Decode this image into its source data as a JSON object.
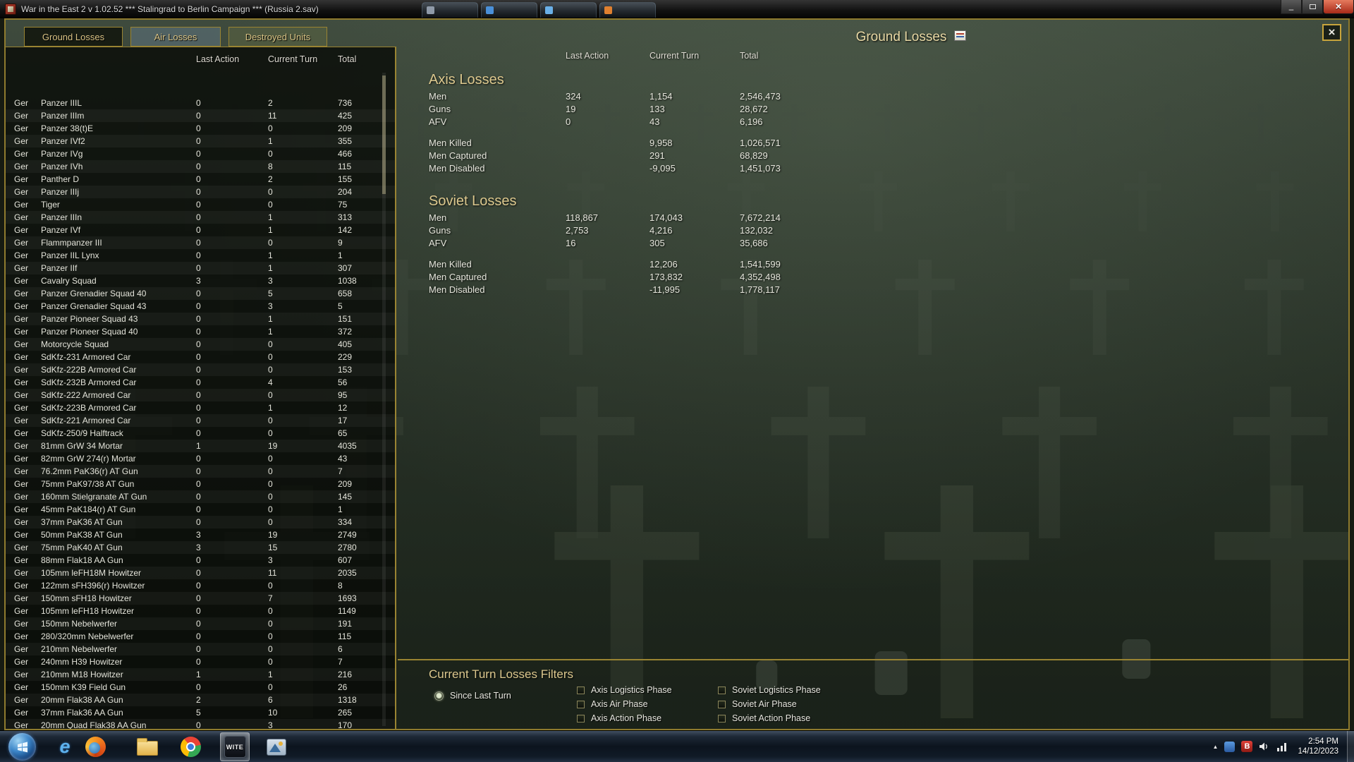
{
  "titlebar": {
    "title": "War in the East 2  v 1.02.52      ***  Stalingrad to Berlin Campaign   ***   (Russia 2.sav)",
    "window_buttons": [
      "minimize",
      "maximize",
      "close"
    ],
    "background_tabs_count": 4
  },
  "window": {
    "title": "Ground Losses",
    "icons": [
      "report-icon",
      "close-icon"
    ]
  },
  "tabs": [
    {
      "label": "Ground Losses",
      "active": true
    },
    {
      "label": "Air Losses",
      "active": false
    },
    {
      "label": "Destroyed Units",
      "active": false
    }
  ],
  "table": {
    "headers": [
      "Last Action",
      "Current Turn",
      "Total"
    ],
    "rows": [
      [
        "Ger",
        "Panzer IIIL",
        "0",
        "2",
        "736"
      ],
      [
        "Ger",
        "Panzer IIIm",
        "0",
        "11",
        "425"
      ],
      [
        "Ger",
        "Panzer 38(t)E",
        "0",
        "0",
        "209"
      ],
      [
        "Ger",
        "Panzer IVf2",
        "0",
        "1",
        "355"
      ],
      [
        "Ger",
        "Panzer IVg",
        "0",
        "0",
        "466"
      ],
      [
        "Ger",
        "Panzer IVh",
        "0",
        "8",
        "115"
      ],
      [
        "Ger",
        "Panther D",
        "0",
        "2",
        "155"
      ],
      [
        "Ger",
        "Panzer IIIj",
        "0",
        "0",
        "204"
      ],
      [
        "Ger",
        "Tiger",
        "0",
        "0",
        "75"
      ],
      [
        "Ger",
        "Panzer IIIn",
        "0",
        "1",
        "313"
      ],
      [
        "Ger",
        "Panzer IVf",
        "0",
        "1",
        "142"
      ],
      [
        "Ger",
        "Flammpanzer III",
        "0",
        "0",
        "9"
      ],
      [
        "Ger",
        "Panzer IIL Lynx",
        "0",
        "1",
        "1"
      ],
      [
        "Ger",
        "Panzer IIf",
        "0",
        "1",
        "307"
      ],
      [
        "Ger",
        "Cavalry Squad",
        "3",
        "3",
        "1038"
      ],
      [
        "Ger",
        "Panzer Grenadier Squad 40",
        "0",
        "5",
        "658"
      ],
      [
        "Ger",
        "Panzer Grenadier Squad 43",
        "0",
        "3",
        "5"
      ],
      [
        "Ger",
        "Panzer Pioneer Squad 43",
        "0",
        "1",
        "151"
      ],
      [
        "Ger",
        "Panzer Pioneer Squad 40",
        "0",
        "1",
        "372"
      ],
      [
        "Ger",
        "Motorcycle Squad",
        "0",
        "0",
        "405"
      ],
      [
        "Ger",
        "SdKfz-231 Armored Car",
        "0",
        "0",
        "229"
      ],
      [
        "Ger",
        "SdKfz-222B Armored Car",
        "0",
        "0",
        "153"
      ],
      [
        "Ger",
        "SdKfz-232B Armored Car",
        "0",
        "4",
        "56"
      ],
      [
        "Ger",
        "SdKfz-222 Armored Car",
        "0",
        "0",
        "95"
      ],
      [
        "Ger",
        "SdKfz-223B Armored Car",
        "0",
        "1",
        "12"
      ],
      [
        "Ger",
        "SdKfz-221 Armored Car",
        "0",
        "0",
        "17"
      ],
      [
        "Ger",
        "SdKfz-250/9 Halftrack",
        "0",
        "0",
        "65"
      ],
      [
        "Ger",
        "81mm GrW 34 Mortar",
        "1",
        "19",
        "4035"
      ],
      [
        "Ger",
        "82mm GrW 274(r) Mortar",
        "0",
        "0",
        "43"
      ],
      [
        "Ger",
        "76.2mm PaK36(r) AT Gun",
        "0",
        "0",
        "7"
      ],
      [
        "Ger",
        "75mm PaK97/38 AT Gun",
        "0",
        "0",
        "209"
      ],
      [
        "Ger",
        "160mm Stielgranate AT Gun",
        "0",
        "0",
        "145"
      ],
      [
        "Ger",
        "45mm PaK184(r) AT Gun",
        "0",
        "0",
        "1"
      ],
      [
        "Ger",
        "37mm PaK36 AT Gun",
        "0",
        "0",
        "334"
      ],
      [
        "Ger",
        "50mm PaK38 AT Gun",
        "3",
        "19",
        "2749"
      ],
      [
        "Ger",
        "75mm PaK40 AT Gun",
        "3",
        "15",
        "2780"
      ],
      [
        "Ger",
        "88mm Flak18 AA Gun",
        "0",
        "3",
        "607"
      ],
      [
        "Ger",
        "105mm leFH18M Howitzer",
        "0",
        "11",
        "2035"
      ],
      [
        "Ger",
        "122mm sFH396(r) Howitzer",
        "0",
        "0",
        "8"
      ],
      [
        "Ger",
        "150mm sFH18 Howitzer",
        "0",
        "7",
        "1693"
      ],
      [
        "Ger",
        "105mm leFH18 Howitzer",
        "0",
        "0",
        "1149"
      ],
      [
        "Ger",
        "150mm Nebelwerfer",
        "0",
        "0",
        "191"
      ],
      [
        "Ger",
        "280/320mm Nebelwerfer",
        "0",
        "0",
        "115"
      ],
      [
        "Ger",
        "210mm Nebelwerfer",
        "0",
        "0",
        "6"
      ],
      [
        "Ger",
        "240mm H39 Howitzer",
        "0",
        "0",
        "7"
      ],
      [
        "Ger",
        "210mm M18 Howitzer",
        "1",
        "1",
        "216"
      ],
      [
        "Ger",
        "150mm K39 Field Gun",
        "0",
        "0",
        "26"
      ],
      [
        "Ger",
        "20mm Flak38 AA Gun",
        "2",
        "6",
        "1318"
      ],
      [
        "Ger",
        "37mm Flak36 AA Gun",
        "5",
        "10",
        "265"
      ],
      [
        "Ger",
        "20mm Quad Flak38 AA Gun",
        "0",
        "3",
        "170"
      ]
    ]
  },
  "summary": {
    "headers": [
      "Last Action",
      "Current Turn",
      "Total"
    ],
    "sections": [
      {
        "title": "Axis Losses",
        "main_rows": [
          [
            "Men",
            "324",
            "1,154",
            "2,546,473"
          ],
          [
            "Guns",
            "19",
            "133",
            "28,672"
          ],
          [
            "AFV",
            "0",
            "43",
            "6,196"
          ]
        ],
        "detail_rows": [
          [
            "Men Killed",
            "",
            "9,958",
            "1,026,571"
          ],
          [
            "Men Captured",
            "",
            "291",
            "68,829"
          ],
          [
            "Men Disabled",
            "",
            "-9,095",
            "1,451,073"
          ]
        ]
      },
      {
        "title": "Soviet Losses",
        "main_rows": [
          [
            "Men",
            "118,867",
            "174,043",
            "7,672,214"
          ],
          [
            "Guns",
            "2,753",
            "4,216",
            "132,032"
          ],
          [
            "AFV",
            "16",
            "305",
            "35,686"
          ]
        ],
        "detail_rows": [
          [
            "Men Killed",
            "",
            "12,206",
            "1,541,599"
          ],
          [
            "Men Captured",
            "",
            "173,832",
            "4,352,498"
          ],
          [
            "Men Disabled",
            "",
            "-11,995",
            "1,778,117"
          ]
        ]
      }
    ]
  },
  "filters": {
    "title": "Current Turn Losses Filters",
    "radio_label": "Since Last Turn",
    "radio_selected": true,
    "column1": [
      "Axis Logistics Phase",
      "Axis Air Phase",
      "Axis Action Phase"
    ],
    "column2": [
      "Soviet Logistics Phase",
      "Soviet Air Phase",
      "Soviet Action Phase"
    ]
  },
  "taskbar": {
    "wite_label": "WITE",
    "tray_b": "B",
    "time": "2:54 PM",
    "date": "14/12/2023",
    "icons": [
      "start-orb",
      "internet-explorer",
      "firefox",
      "windows-explorer",
      "chrome",
      "wite-game",
      "photo-viewer"
    ],
    "tray_icons": [
      "hidden-icons-chevron",
      "blue-app",
      "b-app",
      "speaker",
      "network"
    ]
  },
  "colors": {
    "gold_border": "#8f7b2e",
    "tab_text": "#d8c284",
    "section_title": "#dcc88e",
    "close_red": "#a72a18",
    "background_olive": "#3a473a"
  }
}
